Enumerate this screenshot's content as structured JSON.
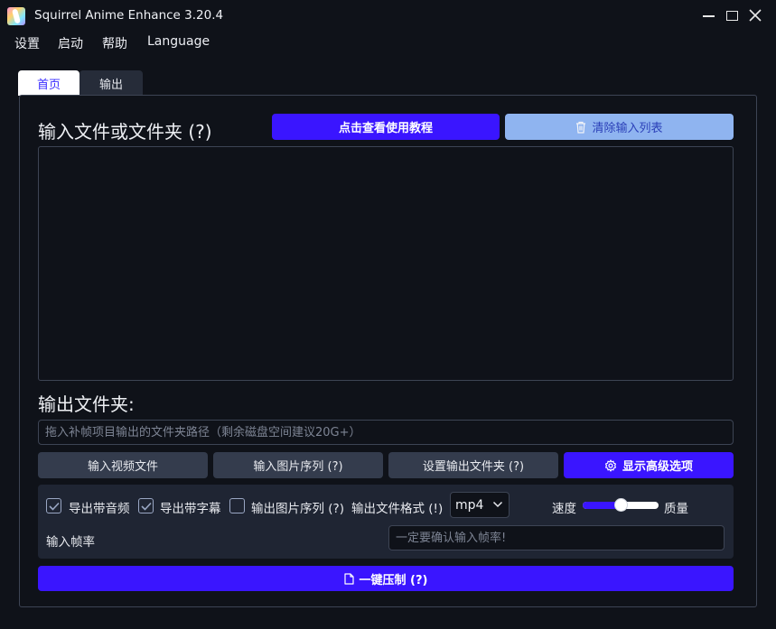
{
  "window": {
    "title": "Squirrel Anime Enhance 3.20.4",
    "logo_icon": "app-logo-icon",
    "controls": [
      "minimize-icon",
      "maximize-icon",
      "close-icon"
    ]
  },
  "menu": {
    "items": [
      "设置",
      "启动",
      "帮助",
      "Language"
    ]
  },
  "tabs": {
    "home": "首页",
    "output": "输出",
    "active": "home"
  },
  "input_section": {
    "title": "输入文件或文件夹 (?)",
    "tutorial_button": "点击查看使用教程",
    "clear_button": "清除输入列表",
    "clear_icon": "trash-icon",
    "files": []
  },
  "output_section": {
    "title": "输出文件夹:",
    "path_value": "",
    "path_placeholder": "拖入补帧项目输出的文件夹路径（剩余磁盘空间建议20G+）"
  },
  "action_buttons": {
    "input_video": "输入视频文件",
    "input_images": "输入图片序列 (?)",
    "set_output": "设置输出文件夹 (?)",
    "advanced": "显示高级选项",
    "advanced_icon": "gear-icon"
  },
  "options": {
    "export_audio": {
      "label": "导出带音频",
      "checked": true
    },
    "export_subtitles": {
      "label": "导出带字幕",
      "checked": true
    },
    "export_image_seq": {
      "label": "输出图片序列 (?)",
      "checked": false
    },
    "format_label": "输出文件格式 (!)",
    "format_value": "mp4",
    "speed_label": "速度",
    "quality_label": "质量",
    "speed_quality_level": 0.5,
    "fps_label": "输入帧率",
    "fps_value": "",
    "fps_placeholder": "一定要确认输入帧率!"
  },
  "compress_button": {
    "label": "一键压制 (?)",
    "icon": "file-icon"
  },
  "colors": {
    "accent": "#3a15ff",
    "background": "#0f1219",
    "panel": "#1f2533",
    "button": "#343c4d",
    "light_button": "#8fb4f0"
  }
}
